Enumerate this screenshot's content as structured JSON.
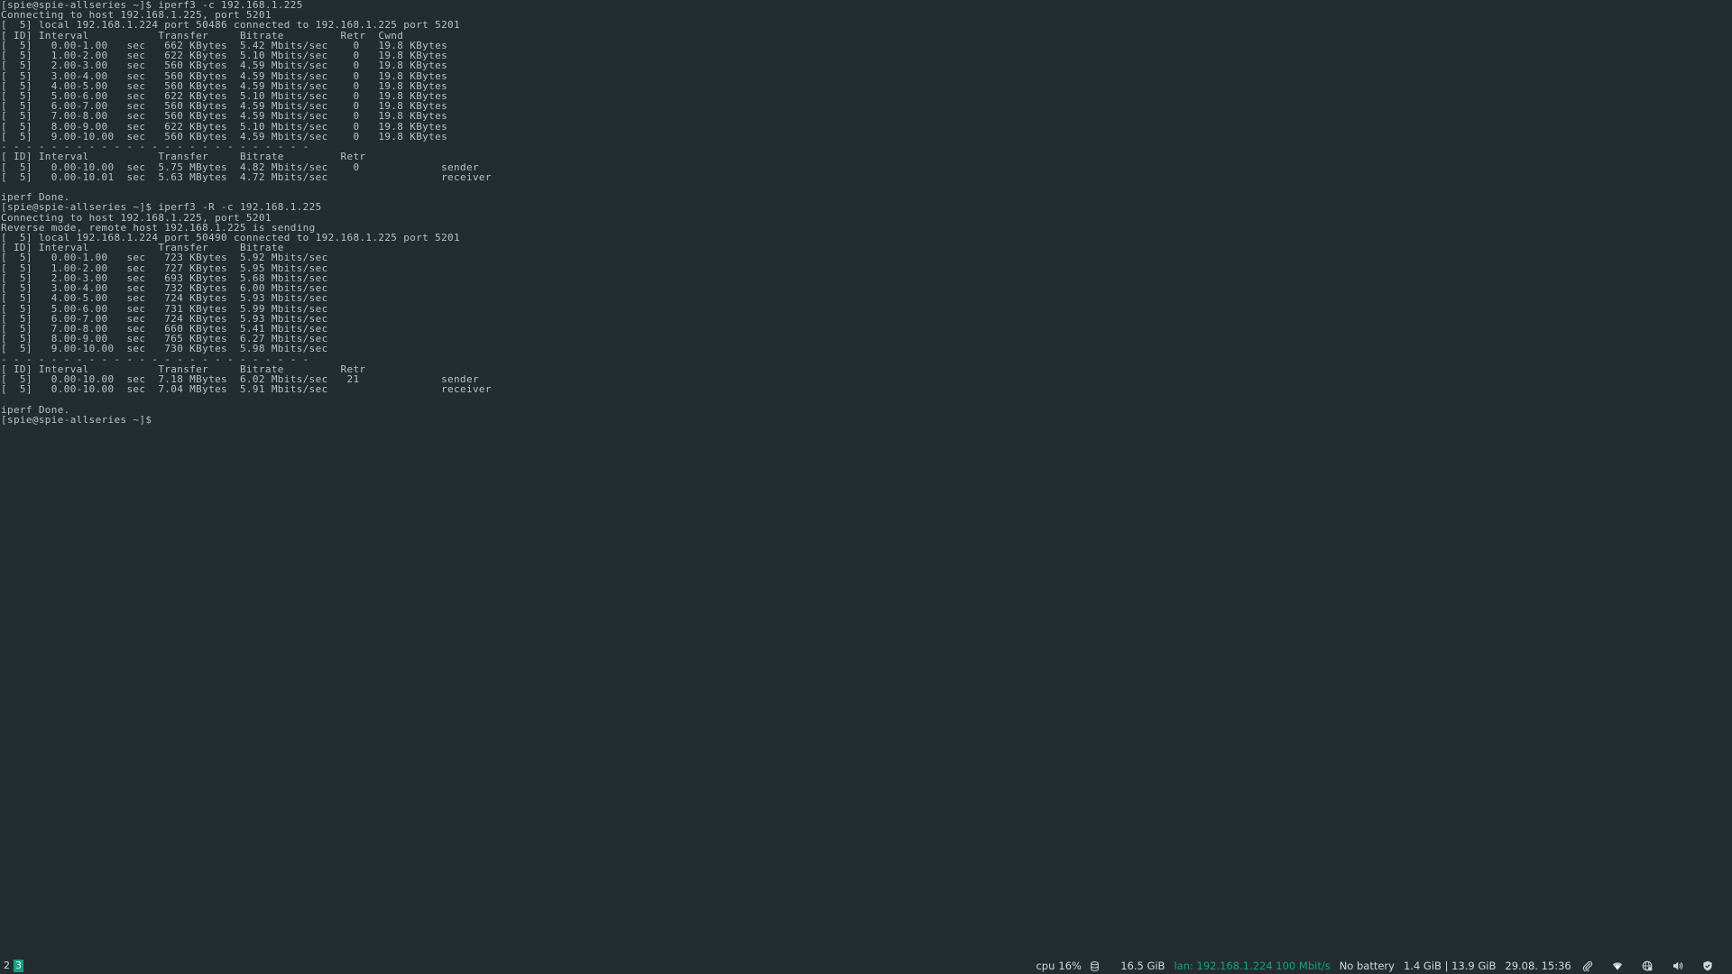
{
  "terminal": {
    "lines": [
      "[spie@spie-allseries ~]$ iperf3 -c 192.168.1.225",
      "Connecting to host 192.168.1.225, port 5201",
      "[  5] local 192.168.1.224 port 50486 connected to 192.168.1.225 port 5201",
      "[ ID] Interval           Transfer     Bitrate         Retr  Cwnd",
      "[  5]   0.00-1.00   sec   662 KBytes  5.42 Mbits/sec    0   19.8 KBytes",
      "[  5]   1.00-2.00   sec   622 KBytes  5.10 Mbits/sec    0   19.8 KBytes",
      "[  5]   2.00-3.00   sec   560 KBytes  4.59 Mbits/sec    0   19.8 KBytes",
      "[  5]   3.00-4.00   sec   560 KBytes  4.59 Mbits/sec    0   19.8 KBytes",
      "[  5]   4.00-5.00   sec   560 KBytes  4.59 Mbits/sec    0   19.8 KBytes",
      "[  5]   5.00-6.00   sec   622 KBytes  5.10 Mbits/sec    0   19.8 KBytes",
      "[  5]   6.00-7.00   sec   560 KBytes  4.59 Mbits/sec    0   19.8 KBytes",
      "[  5]   7.00-8.00   sec   560 KBytes  4.59 Mbits/sec    0   19.8 KBytes",
      "[  5]   8.00-9.00   sec   622 KBytes  5.10 Mbits/sec    0   19.8 KBytes",
      "[  5]   9.00-10.00  sec   560 KBytes  4.59 Mbits/sec    0   19.8 KBytes",
      "- - - - - - - - - - - - - - - - - - - - - - - - -",
      "[ ID] Interval           Transfer     Bitrate         Retr",
      "[  5]   0.00-10.00  sec  5.75 MBytes  4.82 Mbits/sec    0             sender",
      "[  5]   0.00-10.01  sec  5.63 MBytes  4.72 Mbits/sec                  receiver",
      "",
      "iperf Done.",
      "[spie@spie-allseries ~]$ iperf3 -R -c 192.168.1.225",
      "Connecting to host 192.168.1.225, port 5201",
      "Reverse mode, remote host 192.168.1.225 is sending",
      "[  5] local 192.168.1.224 port 50490 connected to 192.168.1.225 port 5201",
      "[ ID] Interval           Transfer     Bitrate",
      "[  5]   0.00-1.00   sec   723 KBytes  5.92 Mbits/sec",
      "[  5]   1.00-2.00   sec   727 KBytes  5.95 Mbits/sec",
      "[  5]   2.00-3.00   sec   693 KBytes  5.68 Mbits/sec",
      "[  5]   3.00-4.00   sec   732 KBytes  6.00 Mbits/sec",
      "[  5]   4.00-5.00   sec   724 KBytes  5.93 Mbits/sec",
      "[  5]   5.00-6.00   sec   731 KBytes  5.99 Mbits/sec",
      "[  5]   6.00-7.00   sec   724 KBytes  5.93 Mbits/sec",
      "[  5]   7.00-8.00   sec   660 KBytes  5.41 Mbits/sec",
      "[  5]   8.00-9.00   sec   765 KBytes  6.27 Mbits/sec",
      "[  5]   9.00-10.00  sec   730 KBytes  5.98 Mbits/sec",
      "- - - - - - - - - - - - - - - - - - - - - - - - -",
      "[ ID] Interval           Transfer     Bitrate         Retr",
      "[  5]   0.00-10.00  sec  7.18 MBytes  6.02 Mbits/sec   21             sender",
      "[  5]   0.00-10.00  sec  7.04 MBytes  5.91 Mbits/sec                  receiver",
      "",
      "iperf Done.",
      "[spie@spie-allseries ~]$ "
    ]
  },
  "statusbar": {
    "workspaces": [
      {
        "label": "2",
        "active": false
      },
      {
        "label": "3",
        "active": true
      }
    ],
    "cpu_label": "cpu",
    "cpu_value": "16%",
    "disk_icon": "disk-icon",
    "disk_value": "16.5 GiB",
    "lan_text": "lan: 192.168.1.224 100 Mbit/s",
    "battery_text": "No battery",
    "memory_text": "1.4 GiB | 13.9 GiB",
    "datetime_text": "29.08. 15:36",
    "tray_icons": [
      "paperclip-icon",
      "wifi-icon",
      "network-globe-icon",
      "volume-icon",
      "shield-icon"
    ],
    "colors": {
      "background": "#232d31",
      "text": "#b7c1c4",
      "accent": "#16a085"
    }
  }
}
